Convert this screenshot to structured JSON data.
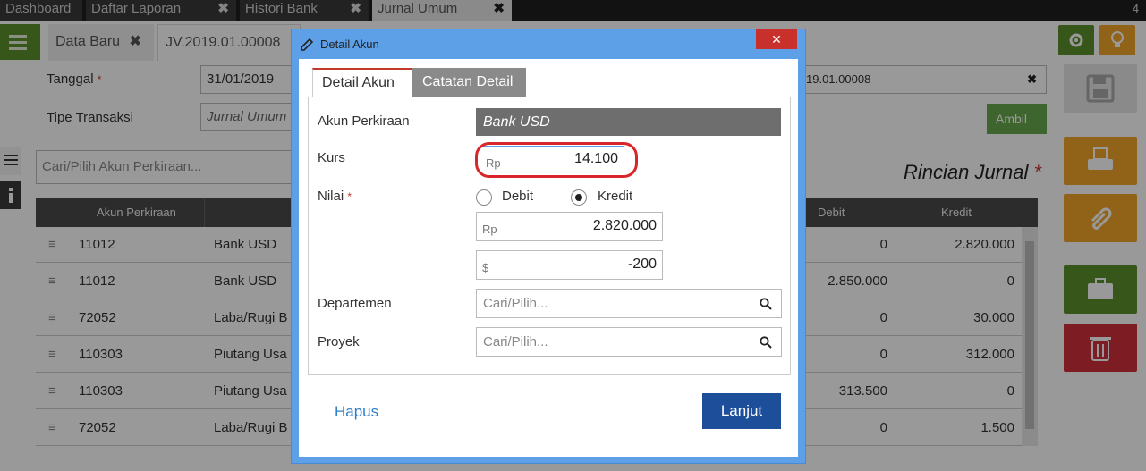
{
  "top_tabs": [
    {
      "label": "Dashboard",
      "closable": false
    },
    {
      "label": "Daftar Laporan",
      "closable": true
    },
    {
      "label": "Histori Bank",
      "closable": true
    },
    {
      "label": "Jurnal Umum",
      "closable": true,
      "active": true
    }
  ],
  "top_tab_count": "4",
  "doc_tabs": {
    "new_label": "Data Baru",
    "doc_label": "JV.2019.01.00008"
  },
  "form": {
    "date_label": "Tanggal",
    "date_value": "31/01/2019",
    "type_label": "Tipe Transaksi",
    "type_value": "Jurnal Umum",
    "ref_value": "19.01.00008",
    "ambil_label": "Ambil"
  },
  "search_placeholder": "Cari/Pilih Akun Perkiraan...",
  "rincian_title": "Rincian Jurnal",
  "table": {
    "headers": {
      "account": "Akun Perkiraan",
      "debit": "Debit",
      "credit": "Kredit"
    },
    "rows": [
      {
        "code": "11012",
        "name": "Bank USD",
        "debit": "0",
        "credit": "2.820.000"
      },
      {
        "code": "11012",
        "name": "Bank USD",
        "debit": "2.850.000",
        "credit": "0"
      },
      {
        "code": "72052",
        "name": "Laba/Rugi B",
        "debit": "0",
        "credit": "30.000"
      },
      {
        "code": "110303",
        "name": "Piutang Usa",
        "debit": "0",
        "credit": "312.000"
      },
      {
        "code": "110303",
        "name": "Piutang Usa",
        "debit": "313.500",
        "credit": "0"
      },
      {
        "code": "72052",
        "name": "Laba/Rugi B",
        "debit": "0",
        "credit": "1.500"
      }
    ]
  },
  "dialog": {
    "title": "Detail Akun",
    "close": "✕",
    "tabs": [
      "Detail Akun",
      "Catatan Detail"
    ],
    "account_label": "Akun Perkiraan",
    "account_value": "Bank USD",
    "kurs_label": "Kurs",
    "kurs_prefix": "Rp",
    "kurs_value": "14.100",
    "nilai_label": "Nilai",
    "debit_label": "Debit",
    "kredit_label": "Kredit",
    "selected": "Kredit",
    "nilai_rp_prefix": "Rp",
    "nilai_rp_value": "2.820.000",
    "nilai_usd_prefix": "$",
    "nilai_usd_value": "-200",
    "departemen_label": "Departemen",
    "departemen_placeholder": "Cari/Pilih...",
    "proyek_label": "Proyek",
    "proyek_placeholder": "Cari/Pilih...",
    "hapus_label": "Hapus",
    "lanjut_label": "Lanjut"
  },
  "colors": {
    "dialog_frame": "#5da0e8",
    "close_red": "#c8302b",
    "highlight_red": "#d9262b",
    "primary_blue": "#1d4e9a",
    "green": "#5a8f2c",
    "orange": "#f0a62a",
    "danger": "#d0303a"
  },
  "icons": [
    "list-icon",
    "close-icon",
    "gear-icon",
    "bulb-icon",
    "save-icon",
    "print-icon",
    "attach-icon",
    "briefcase-icon",
    "trash-icon",
    "pencil-icon",
    "search-icon",
    "info-icon"
  ]
}
